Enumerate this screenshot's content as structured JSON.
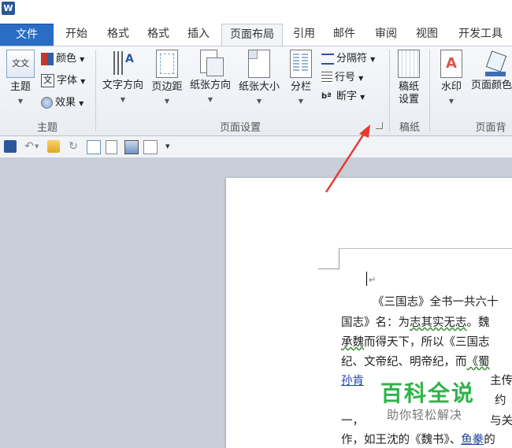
{
  "title_bar": {
    "app_icon": "W"
  },
  "tabs": [
    {
      "label": "文件"
    },
    {
      "label": "开始"
    },
    {
      "label": "格式"
    },
    {
      "label": "格式"
    },
    {
      "label": "插入"
    },
    {
      "label": "页面布局"
    },
    {
      "label": "引用"
    },
    {
      "label": "邮件"
    },
    {
      "label": "审阅"
    },
    {
      "label": "视图"
    },
    {
      "label": "开发工具"
    }
  ],
  "ribbon": {
    "theme_group": {
      "label": "主题",
      "theme_button": "主题",
      "colors": "颜色",
      "fonts": "字体",
      "effects": "效果",
      "theme_icon_text": "文文",
      "font_icon_text": "文"
    },
    "page_setup_group": {
      "label": "页面设置",
      "text_direction": "文字方向",
      "margins": "页边距",
      "orientation": "纸张方向",
      "size": "纸张大小",
      "columns": "分栏",
      "breaks": "分隔符",
      "line_numbers": "行号",
      "hyphenation": "断字"
    },
    "draft_group": {
      "label": "稿纸",
      "draft_settings_1": "稿纸",
      "draft_settings_2": "设置"
    },
    "background_group": {
      "label": "页面背",
      "watermark": "水印",
      "page_color": "页面颜色"
    }
  },
  "document": {
    "line1": "《三国志》全书一共六十",
    "line2a": "国志》名：为",
    "line2b": "志其实无志",
    "line2c": "。魏",
    "line3a": "承魏",
    "line3b": "而得天下，所以《三国志",
    "line4a": "纪、文帝纪、明帝纪，而",
    "line4b": "《蜀",
    "line5a": "孙",
    "line5b": "肯",
    "line5c": "主传",
    "line6a": "约",
    "line7a": "一，",
    "line7b": "与关",
    "line8a": "作，如王沈的《魏书》、",
    "line8b": "鱼豢",
    "line8c": "的"
  },
  "watermark": {
    "title": "百科全说",
    "subtitle": "助你轻松解决"
  },
  "colors": {
    "file_tab": "#2b6cc4",
    "watermark_green": "#2fb34a",
    "annotation_red": "#e8382f"
  }
}
